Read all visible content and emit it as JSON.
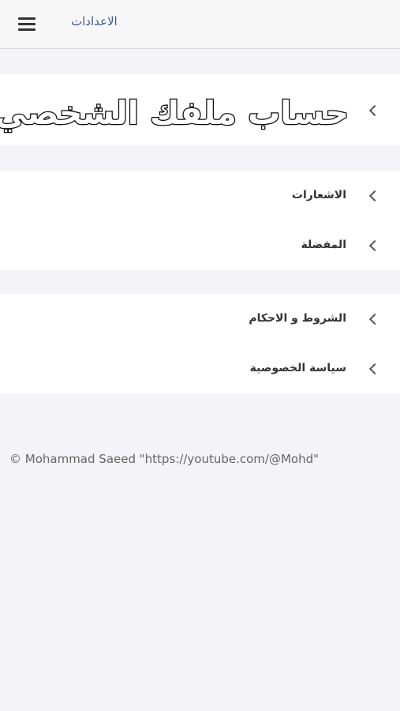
{
  "header": {
    "title": "الاعدادات",
    "menu_icon": "hamburger-menu-icon"
  },
  "profile": {
    "label": "حساب ملفك الشخصي",
    "chevron_icon": "chevron-left-icon"
  },
  "group1": {
    "items": [
      {
        "label": "الاشعارات",
        "icon": "chevron-left-icon"
      },
      {
        "label": "المفضلة",
        "icon": "chevron-left-icon"
      }
    ]
  },
  "group2": {
    "items": [
      {
        "label": "الشروط و الاحكام",
        "icon": "chevron-left-icon"
      },
      {
        "label": "سياسة الخصوصية",
        "icon": "chevron-left-icon"
      }
    ]
  },
  "footer": {
    "text": "© Mohammad Saeed \"https://youtube.com/@Mohd\""
  },
  "colors": {
    "background": "#f3f3f8",
    "header_title": "#3a5a9a",
    "section_bg": "#ffffff"
  }
}
